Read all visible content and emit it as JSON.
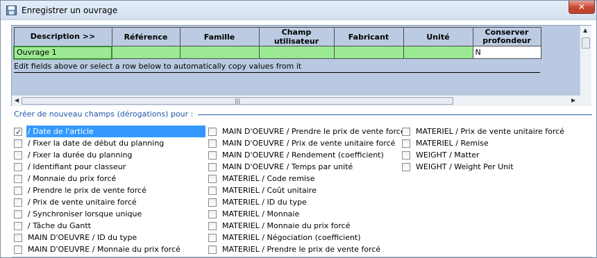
{
  "window": {
    "title": "Enregistrer un ouvrage",
    "close_label": "✕"
  },
  "grid": {
    "columns": [
      "Description >>",
      "Référence",
      "Famille",
      "Champ utilisateur",
      "Fabricant",
      "Unité",
      "Conserver profondeur"
    ],
    "row": [
      "Ouvrage 1",
      "",
      "",
      "",
      "",
      "",
      "N"
    ],
    "hint": "Edit fields above or select a row below to automatically copy values from it",
    "hscroll_grip": "|||"
  },
  "section": {
    "label": "Créer de nouveau champs (dérogations) pour :"
  },
  "checkboxes": {
    "col1": [
      {
        "label": "/ Date de l'article",
        "checked": true,
        "selected": true
      },
      {
        "label": "/ Fixer la date de début du planning",
        "checked": false
      },
      {
        "label": "/ Fixer la durée du planning",
        "checked": false
      },
      {
        "label": "/ Identifiant pour classeur",
        "checked": false
      },
      {
        "label": "/ Monnaie du prix forcé",
        "checked": false
      },
      {
        "label": "/ Prendre le prix de vente forcé",
        "checked": false
      },
      {
        "label": "/ Prix de vente unitaire forcé",
        "checked": false
      },
      {
        "label": "/ Synchroniser lorsque unique",
        "checked": false
      },
      {
        "label": "/ Tâche du Gantt",
        "checked": false
      },
      {
        "label": "MAIN D'OEUVRE / ID du type",
        "checked": false
      },
      {
        "label": "MAIN D'OEUVRE / Monnaie du prix forcé",
        "checked": false
      }
    ],
    "col2": [
      {
        "label": "MAIN D'OEUVRE / Prendre le prix de vente forcé",
        "checked": false
      },
      {
        "label": "MAIN D'OEUVRE / Prix de vente unitaire forcé",
        "checked": false
      },
      {
        "label": "MAIN D'OEUVRE / Rendement (coefficient)",
        "checked": false
      },
      {
        "label": "MAIN D'OEUVRE / Temps par unité",
        "checked": false
      },
      {
        "label": "MATERIEL / Code remise",
        "checked": false
      },
      {
        "label": "MATERIEL / Coût unitaire",
        "checked": false
      },
      {
        "label": "MATERIEL / ID du type",
        "checked": false
      },
      {
        "label": "MATERIEL / Monnaie",
        "checked": false
      },
      {
        "label": "MATERIEL / Monnaie du prix forcé",
        "checked": false
      },
      {
        "label": "MATERIEL / Négociation (coefficient)",
        "checked": false
      },
      {
        "label": "MATERIEL / Prendre le prix de vente forcé",
        "checked": false
      }
    ],
    "col3": [
      {
        "label": "MATERIEL / Prix de vente unitaire forcé",
        "checked": false
      },
      {
        "label": "MATERIEL / Remise",
        "checked": false
      },
      {
        "label": "WEIGHT / Matter",
        "checked": false
      },
      {
        "label": "WEIGHT / Weight Per Unit",
        "checked": false
      }
    ]
  },
  "colors": {
    "grid_header_bg": "#bccbe2",
    "row_highlight": "#9bea93",
    "section_label": "#1f56a8",
    "selection": "#3399ff"
  }
}
